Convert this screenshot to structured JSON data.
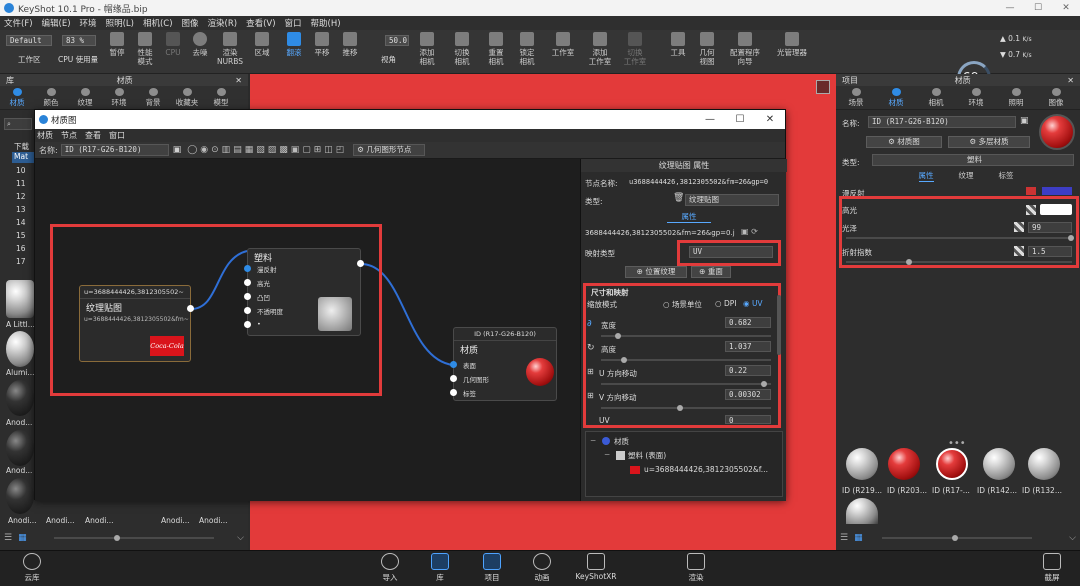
{
  "app": {
    "title": "KeyShot 10.1 Pro - 帽缘品.bip"
  },
  "menu": [
    "文件(F)",
    "编辑(E)",
    "环境",
    "照明(L)",
    "相机(C)",
    "图像",
    "渲染(R)",
    "查看(V)",
    "窗口",
    "帮助(H)"
  ],
  "toolbar": {
    "workspace_value": "Default",
    "zoom_value": "83 %",
    "workspace_label": "工作区",
    "cpu_label": "CPU 使用量",
    "pause_label": "暂停",
    "perf_label": "性能\n模式",
    "cpu2_label": "CPU",
    "denoise_label": "去噪",
    "nurbs_label": "渲染\nNURBS",
    "region_label": "区域",
    "tumble_label": "翻滚",
    "pan_label": "平移",
    "push_label": "推移",
    "fov_value": "50.0",
    "fov_label": "视角",
    "add_camera_label": "添加\n相机",
    "switch_camera_label": "切换\n相机",
    "reset_camera_label": "重置\n相机",
    "lock_camera_label": "锁定\n相机",
    "studio_label": "工作室",
    "add_studio_label": "添加\n工作室",
    "switch_studio_label": "切换\n工作室",
    "tools_label": "工具",
    "geometry_view_label": "几何\n视图",
    "config_label": "配置程序\n向导",
    "light_manager_label": "光管理器",
    "gauge_value": "69",
    "gauge_unit": "%",
    "stat1": "0.1",
    "stat1_unit": "K/s",
    "stat2": "0.7",
    "stat2_unit": "K/s"
  },
  "left_panel": {
    "title": "库",
    "subtitle": "材质",
    "tabs": [
      "材质",
      "颜色",
      "纹理",
      "环境",
      "背景",
      "收藏夹",
      "模型"
    ],
    "tree_header": "下载",
    "tree_selected": "Mat",
    "tree_items": [
      "10",
      "11",
      "12",
      "13",
      "14",
      "15",
      "16",
      "17"
    ],
    "thumb_labels": [
      "A Littl...",
      "Alumi...",
      "Anod...",
      "Anod...",
      "Anod..."
    ],
    "bottom_labels": [
      "Anodi...",
      "Anodi...",
      "Anodi...",
      "Anodi...",
      "Anodi..."
    ]
  },
  "right_panel": {
    "title": "项目",
    "subtitle": "材质",
    "tabs": [
      "场景",
      "材质",
      "相机",
      "环境",
      "照明",
      "图像"
    ],
    "name_label": "名称:",
    "name_value": "ID (R17-G26-B120)",
    "material_graph_btn": "材质图",
    "multilayer_btn": "多层材质",
    "type_label": "类型:",
    "type_value": "塑料",
    "subtabs": [
      "属性",
      "纹理",
      "标签"
    ],
    "diffuse_label": "漫反射",
    "specular_label": "高光",
    "roughness_label": "光泽",
    "roughness_value": "99",
    "ior_label": "折射指数",
    "ior_value": "1.5",
    "material_thumbs": [
      "ID (R219...",
      "ID (R203...",
      "ID (R17-...",
      "ID (R142...",
      "ID (R132..."
    ]
  },
  "dialog": {
    "title": "材质图",
    "menu": [
      "材质",
      "节点",
      "查看",
      "窗口"
    ],
    "name_label": "名称:",
    "name_value": "ID (R17-G26-B120)",
    "geometry_node_btn": "几何图形节点",
    "texture_node": {
      "header": "u=3688444426,3812305502~",
      "title": "纹理贴图",
      "sub": "u=3688444426,3812305502&fm~",
      "logo": "Coca-Cola"
    },
    "plastic_node": {
      "title": "塑料",
      "ports": [
        "漫反射",
        "高光",
        "凸凹",
        "不透明度",
        "•"
      ]
    },
    "material_node": {
      "header": "ID (R17-G26-B120)",
      "title": "材质",
      "ports": [
        "表面",
        "几何图形",
        "标签"
      ]
    },
    "props": {
      "title": "纹理贴图 属性",
      "node_name_label": "节点名称:",
      "node_name_value": "u3688444426,3812305502&fm=26&gp=0",
      "type_label": "类型:",
      "type_value": "纹理贴图",
      "tab_label": "属性",
      "file_value": "3688444426,3812305502&fm=26&gp=0.jpg",
      "mapping_label": "映射类型",
      "mapping_value": "UV",
      "position_btn": "位置纹理",
      "repeat_btn": "重面",
      "section_title": "尺寸和映射",
      "scale_mode_label": "缩放模式",
      "scale_opts": [
        "场景单位",
        "DPI",
        "UV"
      ],
      "width_label": "宽度",
      "width_value": "0.682",
      "height_label": "高度",
      "height_value": "1.037",
      "u_label": "U 方向移动",
      "u_value": "0.22",
      "v_label": "V 方向移动",
      "v_value": "0.00302",
      "uv_label": "UV",
      "uv_value": "0",
      "tree": [
        "材质",
        "塑料 (表面)",
        "u=3688444426,3812305502&f..."
      ]
    }
  },
  "bottom": {
    "cloud_label": "云库",
    "items": [
      "导入",
      "库",
      "项目",
      "动画",
      "KeyShotXR",
      "渲染"
    ],
    "screen_label": "截屏"
  },
  "colors": {
    "accent": "#2f8ce6",
    "viewport": "#e33a3a",
    "highlight": "#e23b3b"
  }
}
